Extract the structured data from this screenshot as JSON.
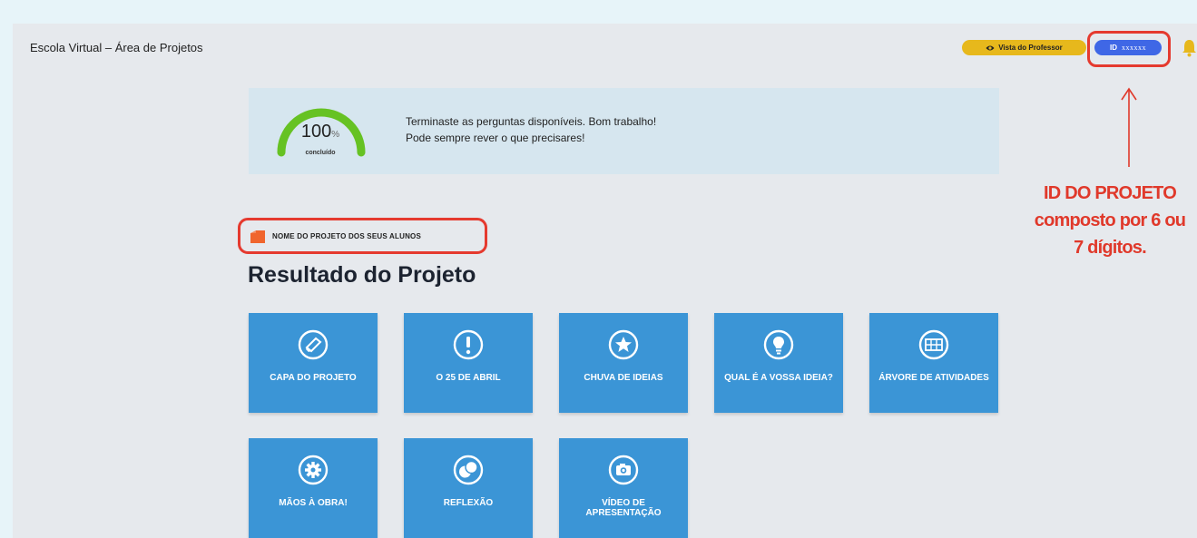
{
  "app": {
    "title": "Escola Virtual – Área de Projetos"
  },
  "header": {
    "teacher_view_label": "Vista do Professor",
    "id_prefix": "ID",
    "id_value": "xxxxxx"
  },
  "annotation": {
    "line1": "ID DO PROJETO",
    "line2": "composto por 6 ou",
    "line3": "7 dígitos.",
    "color": "#e0392b"
  },
  "progress": {
    "value": 100,
    "value_text": "100",
    "unit": "%",
    "label": "concluído",
    "color": "#66c223"
  },
  "banner": {
    "line1": "Terminaste as perguntas disponíveis. Bom trabalho!",
    "line2": "Pode sempre rever o que precisares!"
  },
  "project": {
    "name": "NOME DO PROJETO DOS SEUS ALUNOS",
    "icon_color": "#f0652d"
  },
  "section_title": "Resultado do Projeto",
  "tiles": [
    {
      "label": "CAPA DO PROJETO",
      "icon": "book-cover-icon"
    },
    {
      "label": "O 25 DE ABRIL",
      "icon": "exclamation-icon"
    },
    {
      "label": "CHUVA DE IDEIAS",
      "icon": "star-icon"
    },
    {
      "label": "QUAL É A VOSSA IDEIA?",
      "icon": "lightbulb-icon"
    },
    {
      "label": "ÁRVORE DE ATIVIDADES",
      "icon": "calendar-grid-icon"
    },
    {
      "label": "MÃOS À OBRA!",
      "icon": "gear-icon"
    },
    {
      "label": "REFLEXÃO",
      "icon": "chat-bubbles-icon"
    },
    {
      "label": "VÍDEO DE APRESENTAÇÃO",
      "icon": "camera-icon"
    }
  ],
  "colors": {
    "tile_blue": "#3b95d6",
    "highlight_red": "#e53a2f",
    "teacher_pill": "#e7b81c",
    "id_pill": "#3f67e6"
  }
}
